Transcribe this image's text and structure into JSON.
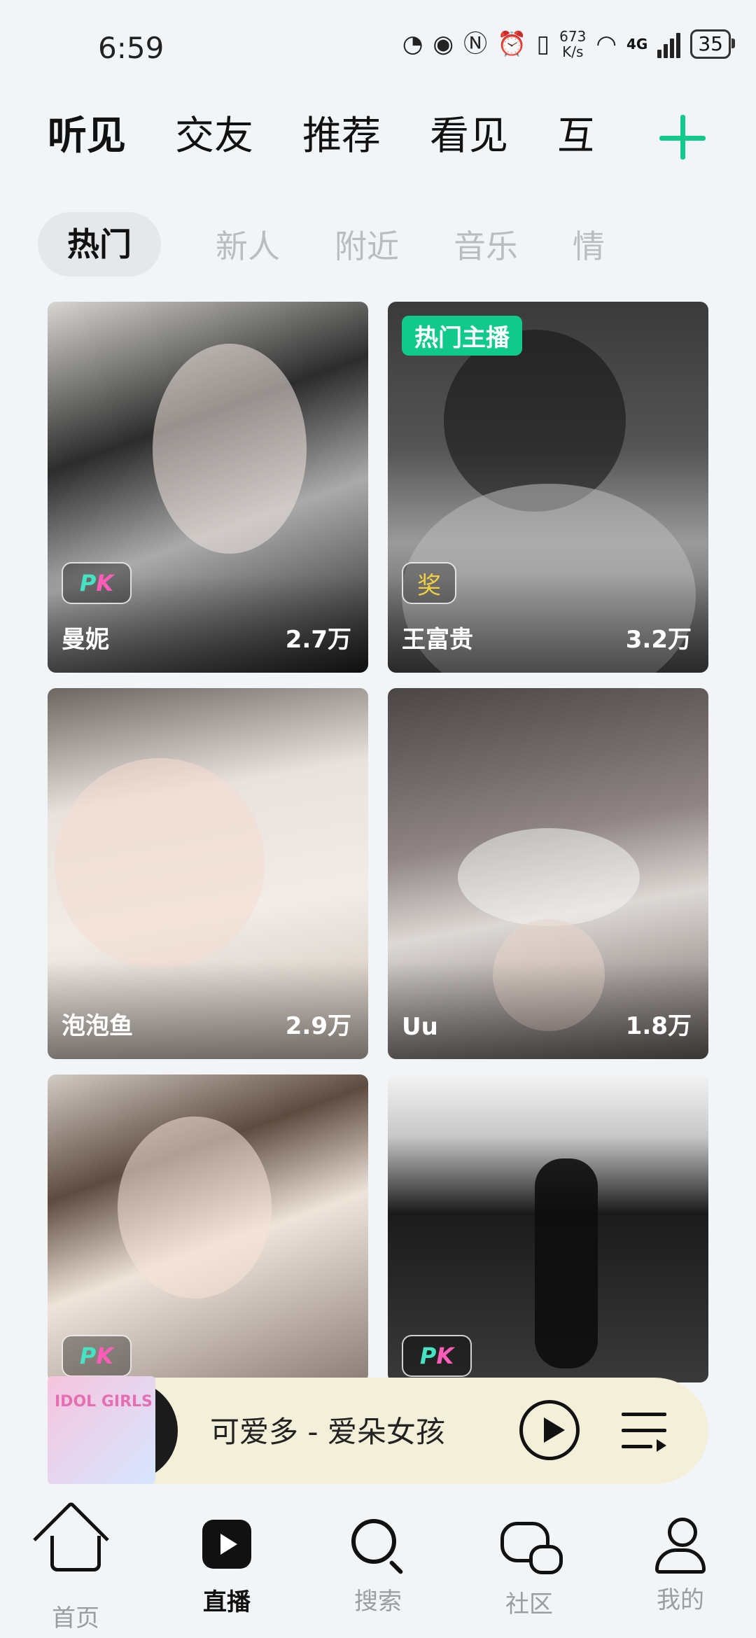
{
  "status_bar": {
    "time": "6:59",
    "speed_value": "673",
    "speed_unit": "K/s",
    "network": "4G",
    "battery": "35"
  },
  "top_tabs": [
    "听见",
    "交友",
    "推荐",
    "看见",
    "互"
  ],
  "sub_tabs": [
    "热门",
    "新人",
    "附近",
    "音乐",
    "情"
  ],
  "cards": [
    {
      "name": "曼妮",
      "count": "2.7万",
      "badge": "PK"
    },
    {
      "name": "王富贵",
      "count": "3.2万",
      "badge": "奖",
      "tag": "热门主播"
    },
    {
      "name": "泡泡鱼",
      "count": "2.9万"
    },
    {
      "name": "Uu",
      "count": "1.8万"
    },
    {
      "badge": "PK"
    },
    {
      "badge": "PK"
    }
  ],
  "player": {
    "cover_text": "IDOL GIRLS",
    "title": "可爱多 - 爱朵女孩"
  },
  "bottom_nav": [
    "首页",
    "直播",
    "搜索",
    "社区",
    "我的"
  ],
  "colors": {
    "accent": "#12c98c",
    "player_bg": "#f3efd9"
  }
}
